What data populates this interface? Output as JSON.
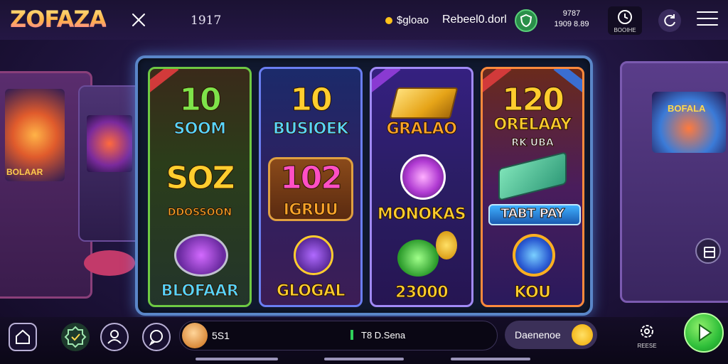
{
  "header": {
    "logo": "ZOFAZA",
    "counter": "1917",
    "balance": "$gloao",
    "account": "Rebeel0.dorl",
    "stats_line1": "9787",
    "stats_line2": "1909 8.89",
    "bonus_label": "BOOIHE"
  },
  "reels": [
    {
      "sym1_top": "10",
      "sym1_bottom": "SOOM",
      "sym2_top": "SOZ",
      "sym2_bottom": "DDOSSOON",
      "sym3": "BLOFAAR"
    },
    {
      "sym1_top": "10",
      "sym1_bottom": "BUSIOEK",
      "sym2_top": "102",
      "sym2_bottom": "IGRUU",
      "sym3": "GLOGAL"
    },
    {
      "sym1": "GRALAO",
      "sym2": "MONOKAS",
      "sym3": "23000"
    },
    {
      "sym1_top": "120",
      "sym1_bottom": "ORELAAY",
      "sym1_sub": "RK UBA",
      "sym2": "TABT PAY",
      "sym3": "KOU"
    }
  ],
  "background": {
    "left_screen_label": "BOLAAR",
    "right_screen_label": "BOFALA"
  },
  "bottom": {
    "pill_number": "5S1",
    "pill_text": "T8 D.Sena",
    "deposit_label": "Daenenoe",
    "settings_label": "REESE"
  },
  "colors": {
    "accent_gold": "#ffcd2e",
    "play_green": "#2fbf3a",
    "panel_border": "#5a86c8"
  },
  "icons": {
    "top_close": "close-x-icon",
    "shield": "shield-icon",
    "refresh": "refresh-icon",
    "menu": "hamburger-menu-icon",
    "home": "home-icon",
    "badge": "badge-check-icon",
    "user": "user-icon",
    "chat": "chat-bubble-icon",
    "settings": "gear-icon",
    "play": "play-icon",
    "layout": "layout-toggle-icon"
  }
}
